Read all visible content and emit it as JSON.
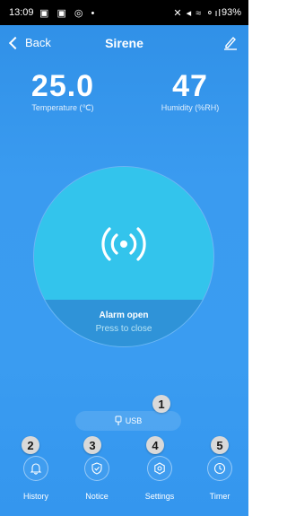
{
  "status_bar": {
    "time": "13:09",
    "left_icons": "▣ ▣ ◎ •",
    "right_icons": "✕ ◂ ≈ ⚬ıl",
    "battery": "93%"
  },
  "header": {
    "back_label": "Back",
    "title": "Sirene"
  },
  "readings": {
    "temperature": {
      "value": "25.0",
      "label": "Temperature (℃)"
    },
    "humidity": {
      "value": "47",
      "label": "Humidity (%RH)"
    }
  },
  "alarm": {
    "status": "Alarm open",
    "hint": "Press to close"
  },
  "power": {
    "label": "USB"
  },
  "badges": [
    "1",
    "2",
    "3",
    "4",
    "5"
  ],
  "nav": [
    {
      "label": "History",
      "icon": "bell-icon"
    },
    {
      "label": "Notice",
      "icon": "shield-check-icon"
    },
    {
      "label": "Settings",
      "icon": "gear-icon"
    },
    {
      "label": "Timer",
      "icon": "clock-icon"
    }
  ],
  "colors": {
    "background": "#3a9bf0",
    "alarm_circle": "#33c4ec",
    "alarm_footer": "#2f93d8",
    "badge": "#d9d9d9"
  }
}
